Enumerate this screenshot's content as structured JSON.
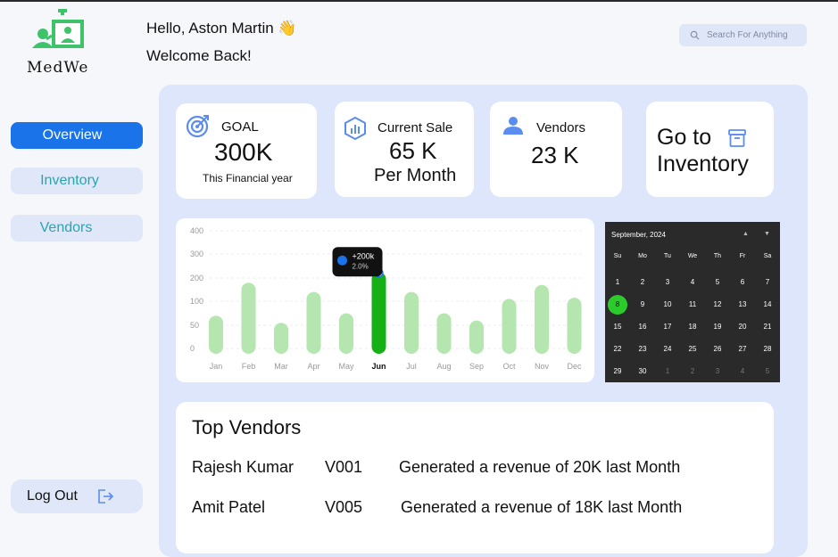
{
  "app": {
    "name": "MedWe"
  },
  "header": {
    "greeting": "Hello, Aston Martin 👋",
    "welcome": "Welcome Back!",
    "search_placeholder": "Search For Anything"
  },
  "sidebar": {
    "items": [
      {
        "label": "Overview",
        "active": true
      },
      {
        "label": "Inventory",
        "active": false
      },
      {
        "label": "Vendors",
        "active": false
      }
    ],
    "logout_label": "Log Out"
  },
  "cards": {
    "goal": {
      "label": "GOAL",
      "value": "300K",
      "sub": "This Financial year"
    },
    "sale": {
      "label": "Current Sale",
      "value": "65 K",
      "sub": "Per Month"
    },
    "vendors": {
      "label": "Vendors",
      "value": "23 K"
    },
    "inventory": {
      "line1": "Go to",
      "line2": "Inventory"
    }
  },
  "chart_data": {
    "type": "bar",
    "categories": [
      "Jan",
      "Feb",
      "Mar",
      "Apr",
      "May",
      "Jun",
      "Jul",
      "Aug",
      "Sep",
      "Oct",
      "Nov",
      "Dec"
    ],
    "values": [
      70,
      180,
      55,
      140,
      75,
      225,
      140,
      75,
      60,
      110,
      170,
      115
    ],
    "highlight_index": 5,
    "ylim": [
      0,
      400
    ],
    "yticks": [
      0,
      50,
      100,
      200,
      300,
      400
    ],
    "tooltip": {
      "value": "+200k",
      "percent": "2.0%"
    },
    "colors": {
      "bar": "#b6e6b0",
      "highlight": "#15b015"
    }
  },
  "calendar": {
    "month": "September, 2024",
    "weekdays": [
      "Su",
      "Mo",
      "Tu",
      "We",
      "Th",
      "Fr",
      "Sa"
    ],
    "weeks": [
      [
        "1",
        "2",
        "3",
        "4",
        "5",
        "6",
        "7"
      ],
      [
        "8",
        "9",
        "10",
        "11",
        "12",
        "13",
        "14"
      ],
      [
        "15",
        "16",
        "17",
        "18",
        "19",
        "20",
        "21"
      ],
      [
        "22",
        "23",
        "24",
        "25",
        "26",
        "27",
        "28"
      ],
      [
        "29",
        "30",
        "1",
        "2",
        "3",
        "4",
        "5"
      ]
    ],
    "selected": "8"
  },
  "top_vendors": {
    "title": "Top Vendors",
    "rows": [
      {
        "name": "Rajesh Kumar",
        "id": "V001",
        "text": "Generated a revenue of 20K last Month"
      },
      {
        "name": "Amit Patel",
        "id": "V005",
        "text": "Generated a revenue of 18K last Month"
      }
    ]
  },
  "colors": {
    "accent": "#1a73e8",
    "panel": "#dde6fb",
    "green": "#15b015",
    "teal": "#2aa5ad"
  }
}
